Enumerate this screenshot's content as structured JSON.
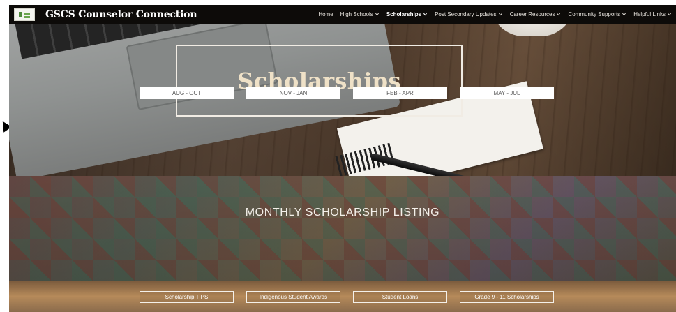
{
  "site": {
    "title": "GSCS Counselor Connection"
  },
  "nav": {
    "items": [
      {
        "label": "Home",
        "dropdown": false,
        "active": false
      },
      {
        "label": "High Schools",
        "dropdown": true,
        "active": false
      },
      {
        "label": "Scholarships",
        "dropdown": true,
        "active": true
      },
      {
        "label": "Post Secondary Updates",
        "dropdown": true,
        "active": false
      },
      {
        "label": "Career Resources",
        "dropdown": true,
        "active": false
      },
      {
        "label": "Community Supports",
        "dropdown": true,
        "active": false
      },
      {
        "label": "Helpful Links",
        "dropdown": true,
        "active": false
      }
    ]
  },
  "hero": {
    "title": "Scholarships"
  },
  "listing": {
    "title": "MONTHLY  SCHOLARSHIP LISTING",
    "months": [
      "AUG - OCT",
      "NOV - JAN",
      "FEB - APR",
      "MAY - JUL"
    ]
  },
  "links": {
    "items": [
      "Scholarship TIPS",
      "Indigenous Student Awards",
      "Student Loans",
      "Grade 9 - 11 Scholarships"
    ]
  },
  "colors": {
    "nav_bg": "#0d0b09",
    "hero_title": "#efe1c7",
    "white": "#ffffff"
  },
  "icons": {
    "logo": "school-logo-icon",
    "dropdown": "chevron-down-icon",
    "pointer": "mouse-pointer-icon"
  }
}
